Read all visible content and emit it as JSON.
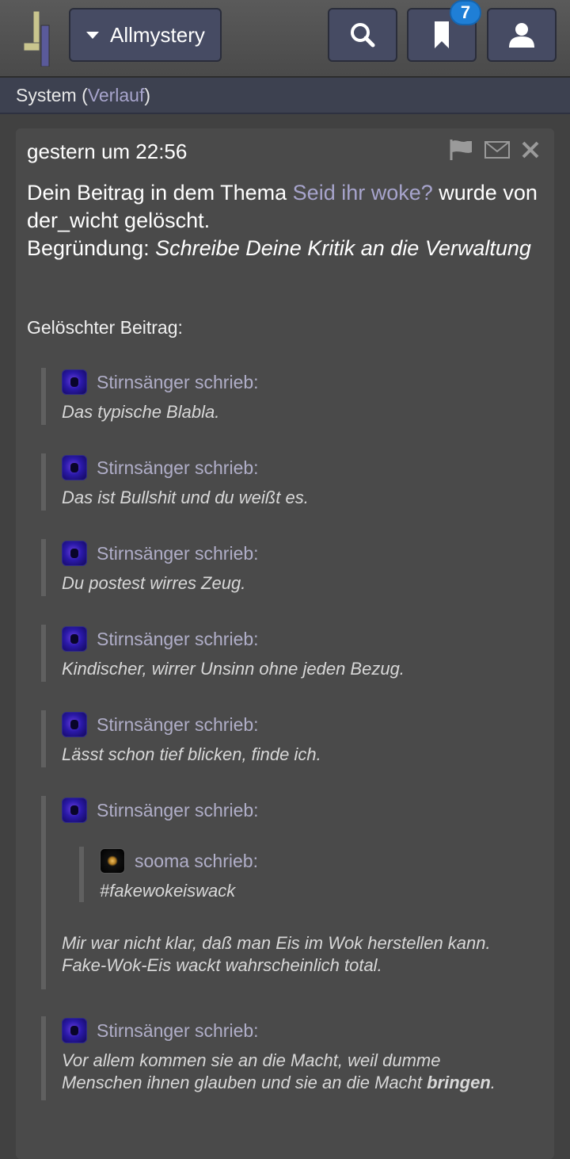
{
  "header": {
    "forum_label": "Allmystery",
    "bookmark_badge": "7",
    "icons": [
      "logo-icon",
      "search-icon",
      "bookmark-icon",
      "user-icon",
      "caret-down-icon"
    ]
  },
  "subnav": {
    "section": "System",
    "open_paren": "(",
    "history_link": "Verlauf",
    "close_paren": ")"
  },
  "notice": {
    "timestamp": "gestern um 22:56",
    "msg_part1": "Dein Beitrag in dem Thema ",
    "topic_link": "Seid ihr woke?",
    "msg_part2": " wurde von der_wicht gelöscht.",
    "reason_label": "Begründung: ",
    "reason_text": "Schreibe Deine Kritik an die Verwaltung",
    "deleted_label": "Gelöschter Beitrag:",
    "icons": [
      "flag-icon",
      "mail-icon",
      "close-icon"
    ]
  },
  "quotes": [
    {
      "author": "Stirnsänger schrieb:",
      "text": "Das typische Blabla."
    },
    {
      "author": "Stirnsänger schrieb:",
      "text": "Das ist Bullshit und du weißt es."
    },
    {
      "author": "Stirnsänger schrieb:",
      "text": "Du postest wirres Zeug."
    },
    {
      "author": "Stirnsänger schrieb:",
      "text": "Kindischer, wirrer Unsinn ohne jeden Bezug."
    },
    {
      "author": "Stirnsänger schrieb:",
      "text": "Lässt schon tief blicken, finde ich."
    },
    {
      "author": "Stirnsänger schrieb:",
      "nested_author": "sooma schrieb:",
      "nested_text": "#fakewokeiswack",
      "text_line1": "Mir war nicht klar, daß man Eis im Wok herstellen kann.",
      "text_line2": "Fake-Wok-Eis wackt wahrscheinlich total."
    },
    {
      "author": "Stirnsänger schrieb:",
      "text_line1": "Vor allem kommen sie an die Macht, weil dumme",
      "text_line2a": "Menschen ihnen glauben und sie an die Macht ",
      "text_bold": "bringen",
      "text_end": "."
    }
  ],
  "colors": {
    "background": "#414141",
    "card": "#4a4a4a",
    "button": "#464b63",
    "link": "#a7a4cc",
    "badge": "#1f7fd6"
  }
}
